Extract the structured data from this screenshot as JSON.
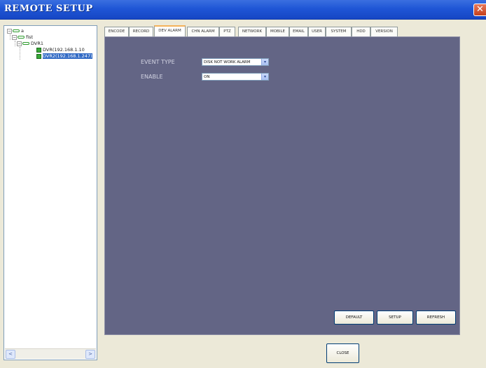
{
  "window": {
    "title": "REMOTE SETUP",
    "close_glyph": "✕"
  },
  "tree": {
    "nodes": [
      {
        "label": "a",
        "toggle": "−"
      },
      {
        "label": "fist",
        "toggle": "−"
      },
      {
        "label": "DVR1",
        "toggle": "−"
      },
      {
        "label": "DVR(192.168.1.10"
      },
      {
        "label": "DVR2(192.168.1.247)",
        "selected": true
      }
    ],
    "scroll_left": "<",
    "scroll_right": ">"
  },
  "tabs": [
    {
      "label": "ENCODE"
    },
    {
      "label": "RECORD"
    },
    {
      "label": "DEV ALARM",
      "active": true
    },
    {
      "label": "CHN ALARM"
    },
    {
      "label": "PTZ"
    },
    {
      "label": "NETWORK"
    },
    {
      "label": "MOBILE"
    },
    {
      "label": "EMAIL"
    },
    {
      "label": "USER"
    },
    {
      "label": "SYSTEM"
    },
    {
      "label": "HDD"
    },
    {
      "label": "VERSION"
    }
  ],
  "form": {
    "event_type": {
      "label": "EVENT TYPE",
      "value": "DISK NOT WORK ALARM"
    },
    "enable": {
      "label": "ENABLE",
      "value": "ON"
    },
    "dropdown_glyph": "▾"
  },
  "buttons": {
    "default": "DEFAULT",
    "setup": "SETUP",
    "refresh": "REFRESH",
    "close": "CLOSE"
  },
  "colors": {
    "titlebar": "#1f56d6",
    "panel": "#636585",
    "selection": "#316ac5",
    "active_tab_accent": "#f4b25a"
  }
}
